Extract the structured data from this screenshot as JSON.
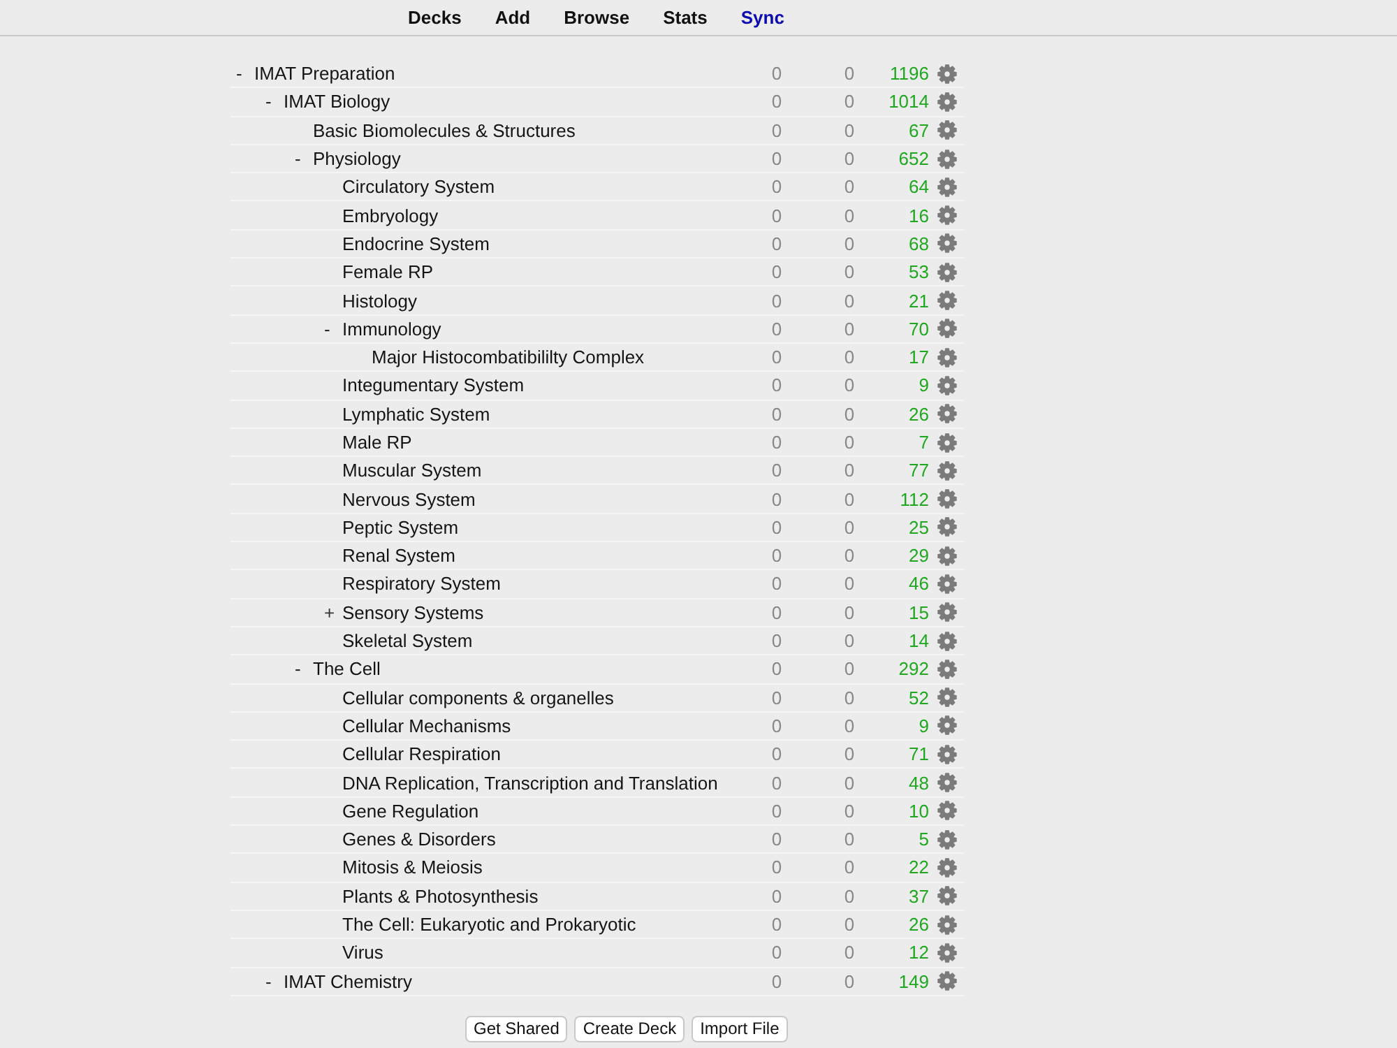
{
  "nav": [
    {
      "label": "Decks",
      "attention": false
    },
    {
      "label": "Add",
      "attention": false
    },
    {
      "label": "Browse",
      "attention": false
    },
    {
      "label": "Stats",
      "attention": false
    },
    {
      "label": "Sync",
      "attention": true
    }
  ],
  "decks": [
    {
      "name": "IMAT Preparation",
      "expander": "-",
      "expanded": true,
      "column_1": "0",
      "column_2": "0",
      "column_3": "1196",
      "children": [
        {
          "name": "IMAT Biology",
          "expander": "-",
          "expanded": true,
          "column_1": "0",
          "column_2": "0",
          "column_3": "1014",
          "children": [
            {
              "name": "Basic Biomolecules & Structures",
              "column_1": "0",
              "column_2": "0",
              "column_3": "67"
            },
            {
              "name": "Physiology",
              "expander": "-",
              "expanded": true,
              "column_1": "0",
              "column_2": "0",
              "column_3": "652",
              "children": [
                {
                  "name": "Circulatory System",
                  "column_1": "0",
                  "column_2": "0",
                  "column_3": "64"
                },
                {
                  "name": "Embryology",
                  "column_1": "0",
                  "column_2": "0",
                  "column_3": "16"
                },
                {
                  "name": "Endocrine System",
                  "column_1": "0",
                  "column_2": "0",
                  "column_3": "68"
                },
                {
                  "name": "Female RP",
                  "column_1": "0",
                  "column_2": "0",
                  "column_3": "53"
                },
                {
                  "name": "Histology",
                  "column_1": "0",
                  "column_2": "0",
                  "column_3": "21"
                },
                {
                  "name": "Immunology",
                  "expander": "-",
                  "expanded": true,
                  "column_1": "0",
                  "column_2": "0",
                  "column_3": "70",
                  "children": [
                    {
                      "name": "Major Histocombatibililty Complex",
                      "column_1": "0",
                      "column_2": "0",
                      "column_3": "17"
                    }
                  ]
                },
                {
                  "name": "Integumentary System",
                  "column_1": "0",
                  "column_2": "0",
                  "column_3": "9"
                },
                {
                  "name": "Lymphatic System",
                  "column_1": "0",
                  "column_2": "0",
                  "column_3": "26"
                },
                {
                  "name": "Male RP",
                  "column_1": "0",
                  "column_2": "0",
                  "column_3": "7"
                },
                {
                  "name": "Muscular System",
                  "column_1": "0",
                  "column_2": "0",
                  "column_3": "77"
                },
                {
                  "name": "Nervous System",
                  "column_1": "0",
                  "column_2": "0",
                  "column_3": "112"
                },
                {
                  "name": "Peptic System",
                  "column_1": "0",
                  "column_2": "0",
                  "column_3": "25"
                },
                {
                  "name": "Renal System",
                  "column_1": "0",
                  "column_2": "0",
                  "column_3": "29"
                },
                {
                  "name": "Respiratory System",
                  "column_1": "0",
                  "column_2": "0",
                  "column_3": "46"
                },
                {
                  "name": "Sensory Systems",
                  "expander": "+",
                  "expanded": false,
                  "column_1": "0",
                  "column_2": "0",
                  "column_3": "15"
                },
                {
                  "name": "Skeletal System",
                  "column_1": "0",
                  "column_2": "0",
                  "column_3": "14"
                }
              ]
            },
            {
              "name": "The Cell",
              "expander": "-",
              "expanded": true,
              "column_1": "0",
              "column_2": "0",
              "column_3": "292",
              "children": [
                {
                  "name": "Cellular components & organelles",
                  "column_1": "0",
                  "column_2": "0",
                  "column_3": "52"
                },
                {
                  "name": "Cellular Mechanisms",
                  "column_1": "0",
                  "column_2": "0",
                  "column_3": "9"
                },
                {
                  "name": "Cellular Respiration",
                  "column_1": "0",
                  "column_2": "0",
                  "column_3": "71"
                },
                {
                  "name": "DNA Replication, Transcription and Translation",
                  "column_1": "0",
                  "column_2": "0",
                  "column_3": "48"
                },
                {
                  "name": "Gene Regulation",
                  "column_1": "0",
                  "column_2": "0",
                  "column_3": "10"
                },
                {
                  "name": "Genes & Disorders",
                  "column_1": "0",
                  "column_2": "0",
                  "column_3": "5"
                },
                {
                  "name": "Mitosis & Meiosis",
                  "column_1": "0",
                  "column_2": "0",
                  "column_3": "22"
                },
                {
                  "name": "Plants & Photosynthesis",
                  "column_1": "0",
                  "column_2": "0",
                  "column_3": "37"
                },
                {
                  "name": "The Cell: Eukaryotic and Prokaryotic",
                  "column_1": "0",
                  "column_2": "0",
                  "column_3": "26"
                },
                {
                  "name": "Virus",
                  "column_1": "0",
                  "column_2": "0",
                  "column_3": "12"
                }
              ]
            }
          ]
        },
        {
          "name": "IMAT Chemistry",
          "expander": "-",
          "expanded": true,
          "column_1": "0",
          "column_2": "0",
          "column_3": "149"
        }
      ]
    }
  ],
  "buttons": [
    "Get Shared",
    "Create Deck",
    "Import File"
  ]
}
